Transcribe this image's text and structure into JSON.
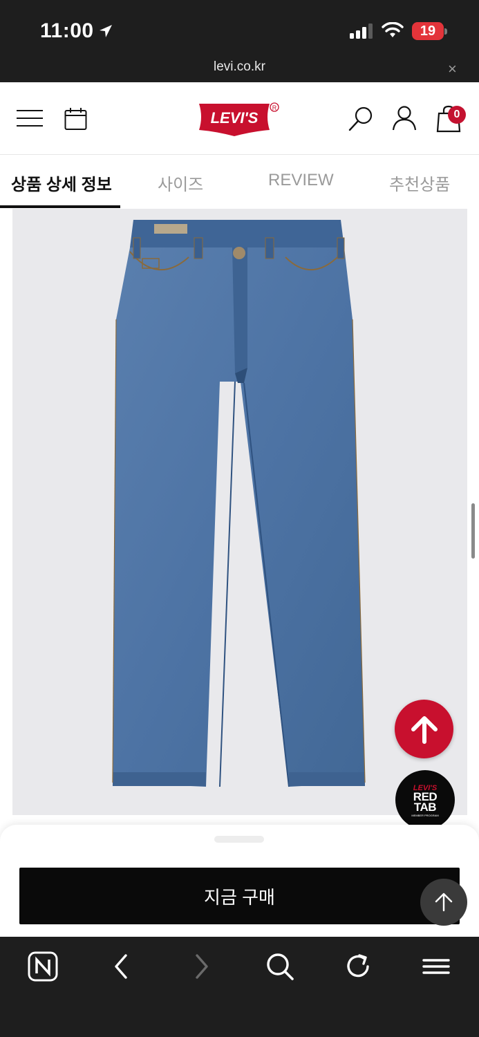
{
  "status_bar": {
    "time": "11:00",
    "battery": "19"
  },
  "browser": {
    "url": "levi.co.kr",
    "close": "×"
  },
  "header": {
    "logo_text": "LEVI'S",
    "cart_count": "0"
  },
  "tabs": [
    {
      "label": "상품 상세 정보",
      "active": true
    },
    {
      "label": "사이즈",
      "active": false
    },
    {
      "label": "REVIEW",
      "active": false
    },
    {
      "label": "추천상품",
      "active": false
    }
  ],
  "product": {
    "image": "jeans-image"
  },
  "floating": {
    "scroll_up_icon": "arrow-up-icon",
    "redtab": {
      "brand": "LEVI'S",
      "line1": "RED",
      "line2": "TAB",
      "sub": "MEMBER PROGRAM"
    }
  },
  "sheet": {
    "buy_label": "지금 구매"
  },
  "toolbar": {
    "icons": [
      "naver-icon",
      "back-icon",
      "forward-icon",
      "search-icon",
      "refresh-icon",
      "menu-icon"
    ]
  },
  "colors": {
    "brand_red": "#c8102e",
    "dark": "#1e1e1e"
  }
}
